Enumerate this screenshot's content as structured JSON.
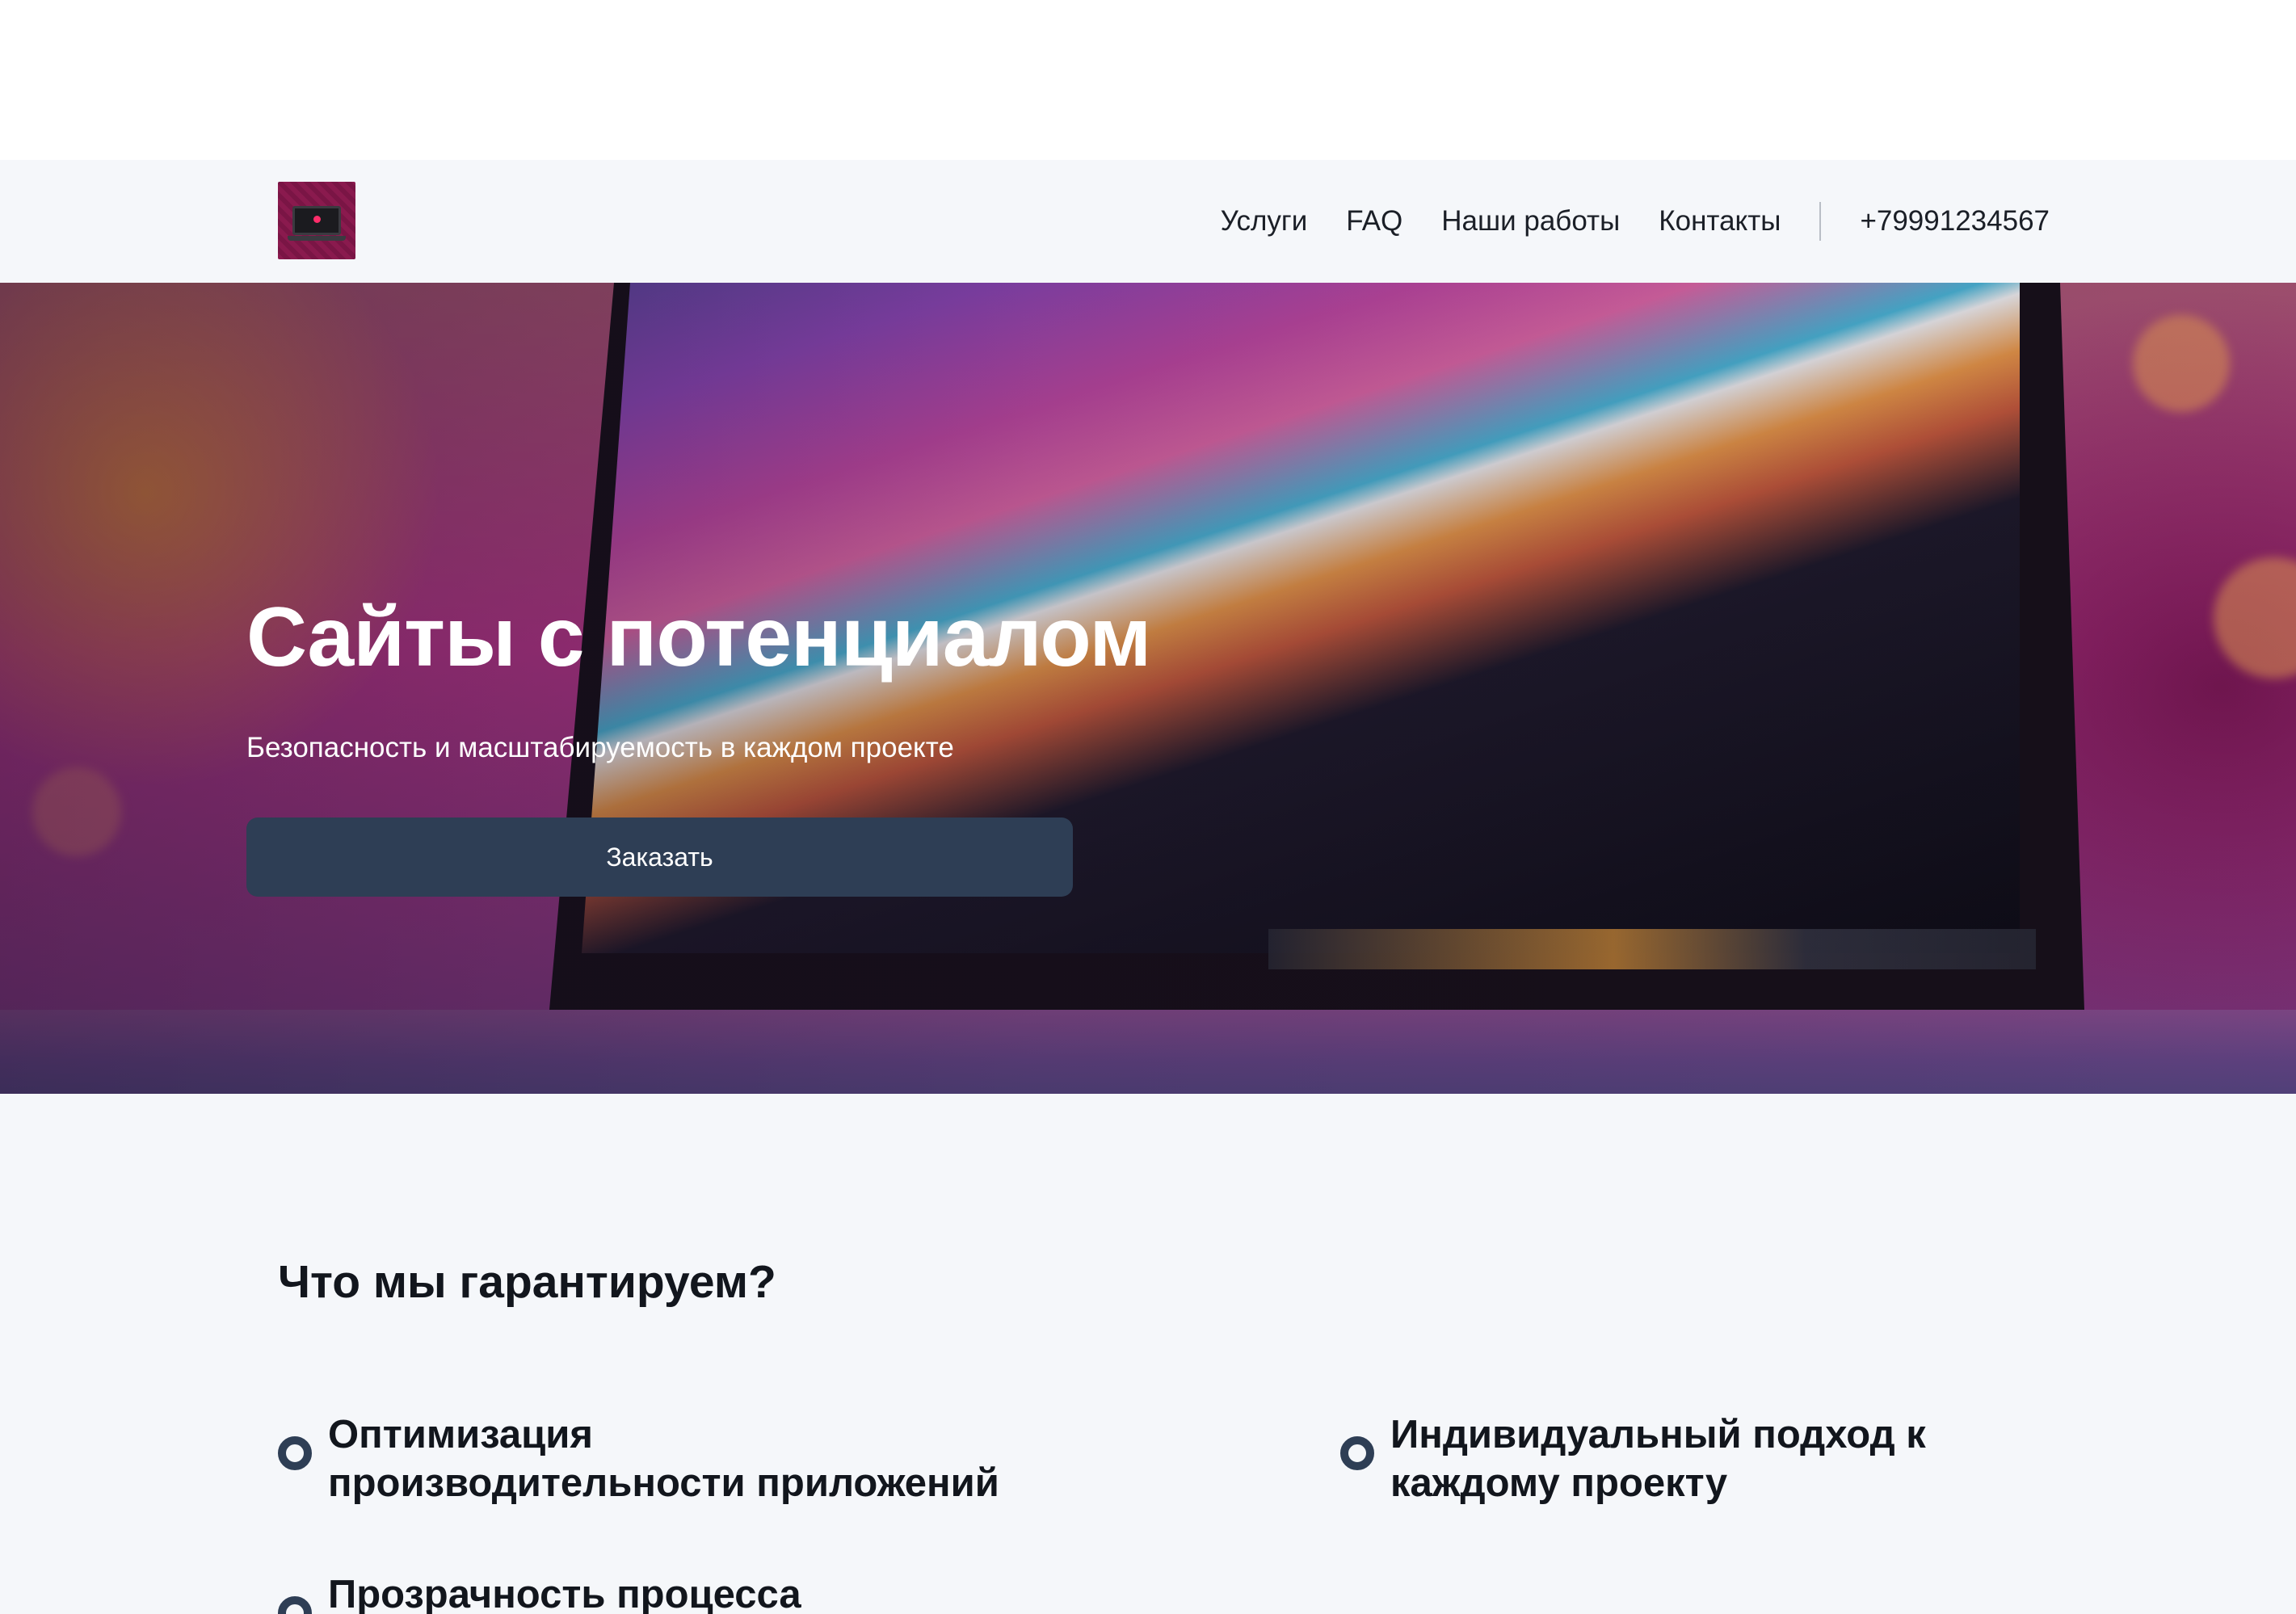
{
  "header": {
    "nav": [
      "Услуги",
      "FAQ",
      "Наши работы",
      "Контакты"
    ],
    "phone": "+79991234567"
  },
  "hero": {
    "title": "Сайты с потенциалом",
    "subtitle": "Безопасность и масштабируемость в каждом проекте",
    "cta_label": "Заказать"
  },
  "guarantees": {
    "title": "Что мы гарантируем?",
    "items": [
      "Оптимизация производительности приложений",
      "Индивидуальный подход к каждому проекту",
      "Прозрачность процесса"
    ]
  },
  "colors": {
    "header_bg": "#f5f7fa",
    "button_bg": "#2e3e55",
    "text_dark": "#12161d",
    "logo_accent": "#8a1a4e"
  },
  "icons": {
    "logo": "laptop-icon",
    "bullet": "ring-bullet-icon"
  }
}
